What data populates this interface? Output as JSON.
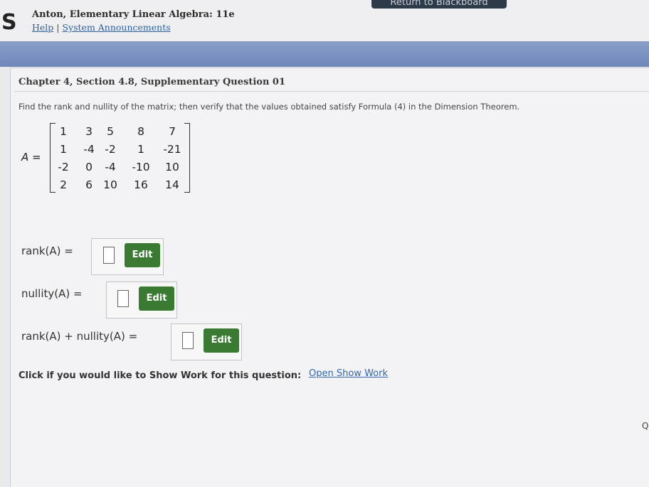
{
  "header": {
    "return_button": "Return to Blackboard",
    "logo": "S",
    "book_title": "Anton, Elementary Linear Algebra: 11e",
    "help_link": "Help",
    "separator": " | ",
    "announcements_link": "System Announcements"
  },
  "question": {
    "title": "Chapter 4, Section 4.8, Supplementary Question 01",
    "prompt": "Find the rank and nullity of the matrix; then verify that the values obtained satisfy Formula (4) in the Dimension Theorem.",
    "matrix_name": "A",
    "matrix_eq": " =",
    "matrix": [
      [
        "1",
        "3",
        "5",
        "8",
        "7"
      ],
      [
        "1",
        "-4",
        "-2",
        "1",
        "-21"
      ],
      [
        "-2",
        "0",
        "-4",
        "-10",
        "10"
      ],
      [
        "2",
        "6",
        "10",
        "16",
        "14"
      ]
    ]
  },
  "answers": {
    "rank_label": "rank(A) =",
    "nullity_label": "nullity(A) =",
    "sum_label": "rank(A) + nullity(A) =",
    "edit_label": "Edit",
    "rank_value": "",
    "nullity_value": "",
    "sum_value": ""
  },
  "show_work": {
    "label": "Click if you would like to Show Work for this question:",
    "link": "Open Show Work"
  },
  "edge_text": "Q"
}
